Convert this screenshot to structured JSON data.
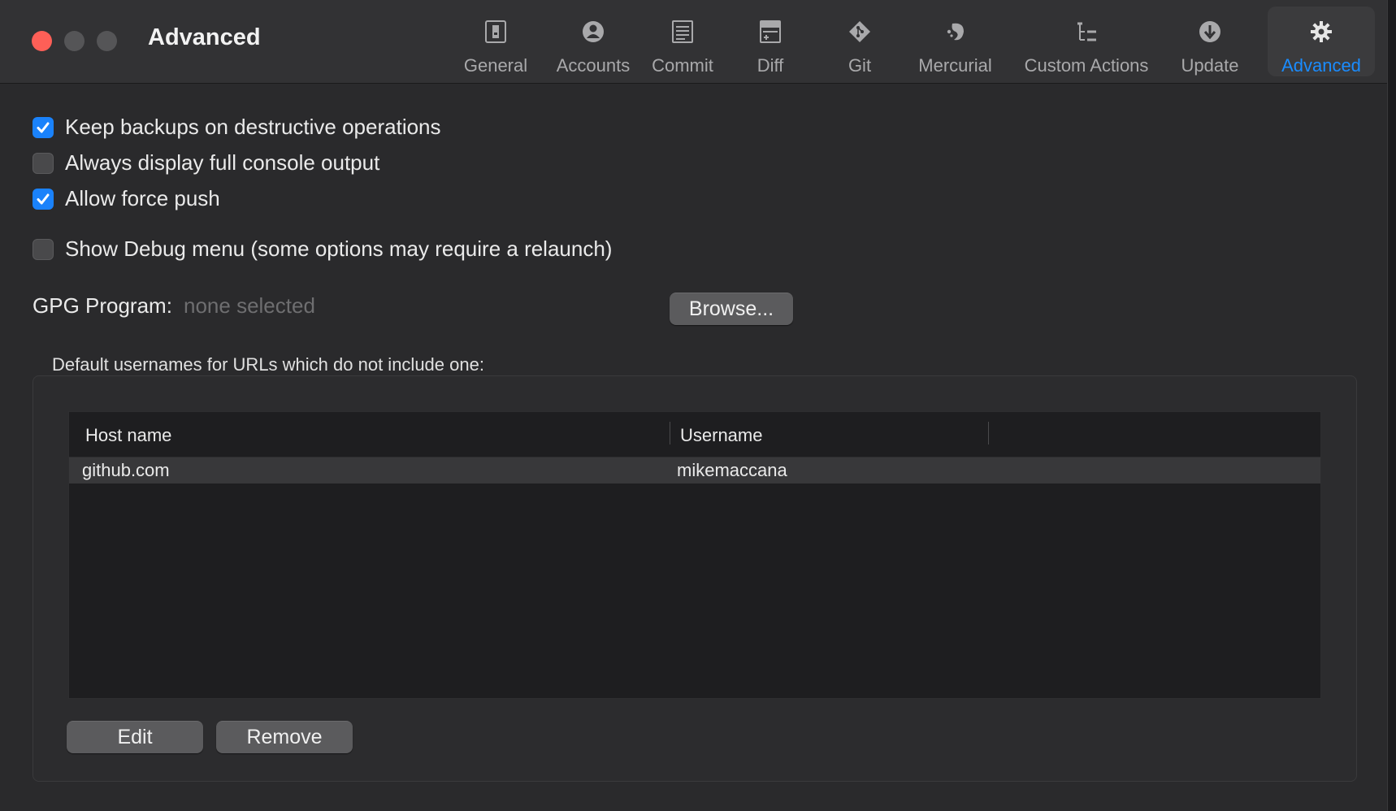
{
  "window": {
    "title": "Advanced",
    "traffic_lights": {
      "close_color": "#fe5f57",
      "inactive_color": "#555557"
    }
  },
  "toolbar": {
    "active_color": "#1a8cff",
    "tabs": [
      {
        "label": "General",
        "icon": "general-icon",
        "active": false
      },
      {
        "label": "Accounts",
        "icon": "accounts-icon",
        "active": false
      },
      {
        "label": "Commit",
        "icon": "commit-icon",
        "active": false
      },
      {
        "label": "Diff",
        "icon": "diff-icon",
        "active": false
      },
      {
        "label": "Git",
        "icon": "git-icon",
        "active": false
      },
      {
        "label": "Mercurial",
        "icon": "mercurial-icon",
        "active": false
      },
      {
        "label": "Custom Actions",
        "icon": "custom-actions-icon",
        "active": false
      },
      {
        "label": "Update",
        "icon": "update-icon",
        "active": false
      },
      {
        "label": "Advanced",
        "icon": "gear-icon",
        "active": true
      }
    ]
  },
  "options": [
    {
      "label": "Keep backups on destructive operations",
      "checked": true
    },
    {
      "label": "Always display full console output",
      "checked": false
    },
    {
      "label": "Allow force push",
      "checked": true
    },
    {
      "label": "Show Debug menu (some options may require a relaunch)",
      "checked": false
    }
  ],
  "gpg": {
    "label": "GPG Program:",
    "value": "none selected",
    "browse_label": "Browse..."
  },
  "usernames": {
    "group_label": "Default usernames for URLs which do not include one:",
    "columns": [
      "Host name",
      "Username"
    ],
    "rows": [
      {
        "host": "github.com",
        "username": "mikemaccana"
      }
    ],
    "edit_label": "Edit",
    "remove_label": "Remove"
  }
}
